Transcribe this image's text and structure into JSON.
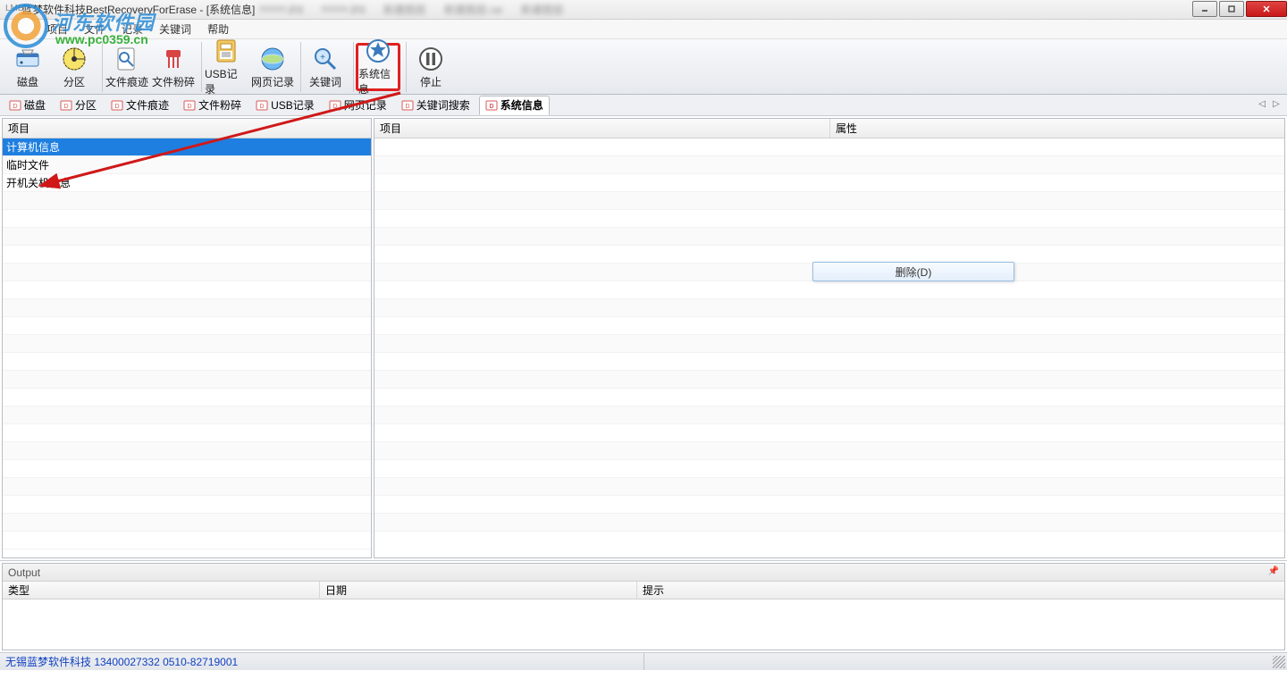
{
  "window": {
    "title": "蓝梦软件科技BestRecoveryForErase - [系统信息]",
    "app_icon_label": "LMB"
  },
  "watermark": {
    "text": "河东软件园",
    "url": "www.pc0359.cn"
  },
  "menu": {
    "items": [
      "项目",
      "文件",
      "记录",
      "关键词",
      "帮助"
    ]
  },
  "toolbar": {
    "groups": [
      {
        "items": [
          {
            "id": "disk",
            "label": "磁盘"
          },
          {
            "id": "partition",
            "label": "分区"
          }
        ]
      },
      {
        "items": [
          {
            "id": "trace",
            "label": "文件痕迹"
          },
          {
            "id": "shred",
            "label": "文件粉碎"
          }
        ]
      },
      {
        "items": [
          {
            "id": "usb",
            "label": "USB记录"
          },
          {
            "id": "web",
            "label": "网页记录"
          }
        ]
      },
      {
        "items": [
          {
            "id": "keyword",
            "label": "关键词"
          }
        ]
      },
      {
        "items": [
          {
            "id": "sysinfo",
            "label": "系统信息",
            "highlighted": true
          }
        ]
      },
      {
        "items": [
          {
            "id": "stop",
            "label": "停止"
          }
        ]
      }
    ]
  },
  "tabs": {
    "items": [
      {
        "label": "磁盘"
      },
      {
        "label": "分区"
      },
      {
        "label": "文件痕迹"
      },
      {
        "label": "文件粉碎"
      },
      {
        "label": "USB记录"
      },
      {
        "label": "网页记录"
      },
      {
        "label": "关键词搜索"
      },
      {
        "label": "系统信息",
        "active": true
      }
    ]
  },
  "left_pane": {
    "header": "项目",
    "rows": [
      {
        "label": "计算机信息",
        "selected": true
      },
      {
        "label": "临时文件"
      },
      {
        "label": "开机关机信息"
      }
    ]
  },
  "right_pane": {
    "col1": "项目",
    "col2": "属性"
  },
  "context_menu": {
    "label": "删除(D)"
  },
  "output": {
    "title": "Output",
    "cols": [
      "类型",
      "日期",
      "提示"
    ]
  },
  "status": {
    "text": "无锡蓝梦软件科技 13400027332  0510-82719001"
  }
}
